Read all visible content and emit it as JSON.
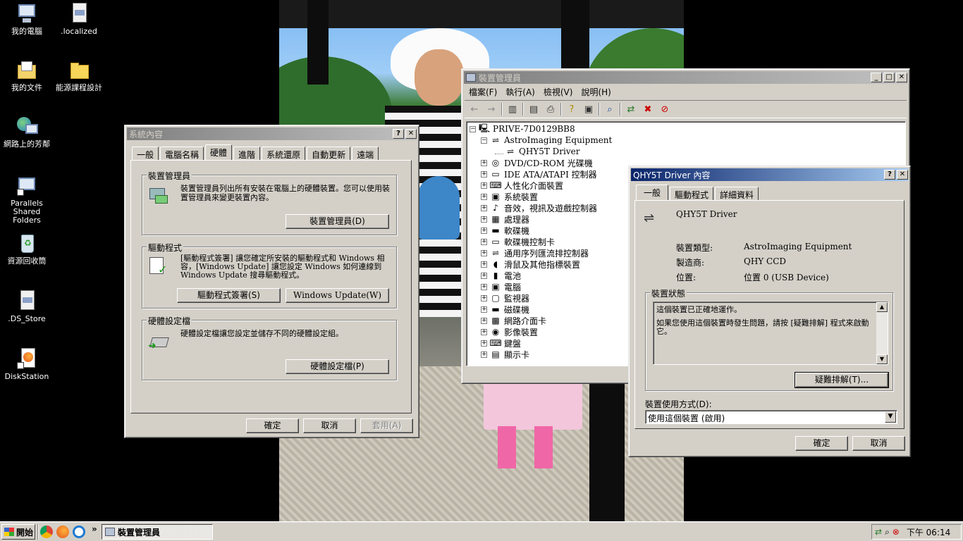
{
  "desktop": {
    "icons": [
      {
        "label": "我的電腦",
        "icon": "my-computer-icon"
      },
      {
        "label": ".localized",
        "icon": "file-icon"
      },
      {
        "label": "我的文件",
        "icon": "my-documents-icon"
      },
      {
        "label": "能源課程設計",
        "icon": "folder-icon"
      },
      {
        "label": "網路上的芳鄰",
        "icon": "network-icon"
      },
      {
        "label": "Parallels Shared Folders",
        "icon": "shared-folders-icon"
      },
      {
        "label": "資源回收筒",
        "icon": "recycle-bin-icon"
      },
      {
        "label": ".DS_Store",
        "icon": "file-icon"
      },
      {
        "label": "DiskStation",
        "icon": "firefox-shortcut-icon"
      }
    ]
  },
  "system_props": {
    "title": "系統內容",
    "tabs": [
      "一般",
      "電腦名稱",
      "硬體",
      "進階",
      "系統還原",
      "自動更新",
      "遠端"
    ],
    "selected_tab": "硬體",
    "device_manager": {
      "heading": "裝置管理員",
      "text": "裝置管理員列出所有安裝在電腦上的硬體裝置。您可以使用裝置管理員來變更裝置內容。",
      "button": "裝置管理員(D)"
    },
    "drivers": {
      "heading": "驅動程式",
      "text": "[驅動程式簽署] 讓您確定所安裝的驅動程式和 Windows 相容，[Windows Update] 讓您設定 Windows 如何連線到 Windows Update 搜尋驅動程式。",
      "btn_signing": "驅動程式簽署(S)",
      "btn_update": "Windows Update(W)"
    },
    "hw_profiles": {
      "heading": "硬體設定檔",
      "text": "硬體設定檔讓您設定並儲存不同的硬體設定組。",
      "button": "硬體設定檔(P)"
    },
    "ok": "確定",
    "cancel": "取消",
    "apply": "套用(A)"
  },
  "device_manager": {
    "title": "裝置管理員",
    "menu": [
      "檔案(F)",
      "執行(A)",
      "檢視(V)",
      "說明(H)"
    ],
    "computer": "PRIVE-7D0129BB8",
    "categories": [
      {
        "label": "AstroImaging Equipment",
        "expanded": true,
        "icon": "usb-icon"
      },
      {
        "label": "QHY5T Driver",
        "child": true,
        "icon": "usb-icon"
      },
      {
        "label": "DVD/CD-ROM 光碟機",
        "icon": "cdrom-icon"
      },
      {
        "label": "IDE ATA/ATAPI 控制器",
        "icon": "ide-controller-icon"
      },
      {
        "label": "人性化介面裝置",
        "icon": "hid-icon"
      },
      {
        "label": "系統裝置",
        "icon": "system-device-icon"
      },
      {
        "label": "音效，視訊及遊戲控制器",
        "icon": "sound-icon"
      },
      {
        "label": "處理器",
        "icon": "processor-icon"
      },
      {
        "label": "軟碟機",
        "icon": "floppy-drive-icon"
      },
      {
        "label": "軟碟機控制卡",
        "icon": "floppy-controller-icon"
      },
      {
        "label": "通用序列匯流排控制器",
        "icon": "usb-controller-icon"
      },
      {
        "label": "滑鼠及其他指標裝置",
        "icon": "mouse-icon"
      },
      {
        "label": "電池",
        "icon": "battery-icon"
      },
      {
        "label": "電腦",
        "icon": "computer-icon"
      },
      {
        "label": "監視器",
        "icon": "monitor-icon"
      },
      {
        "label": "磁碟機",
        "icon": "disk-drive-icon"
      },
      {
        "label": "網路介面卡",
        "icon": "network-adapter-icon"
      },
      {
        "label": "影像裝置",
        "icon": "imaging-device-icon"
      },
      {
        "label": "鍵盤",
        "icon": "keyboard-icon"
      },
      {
        "label": "顯示卡",
        "icon": "display-adapter-icon"
      }
    ]
  },
  "qhy_props": {
    "title": "QHY5T Driver 內容",
    "tabs": [
      "一般",
      "驅動程式",
      "詳細資料"
    ],
    "selected_tab": "一般",
    "device_name": "QHY5T Driver",
    "type_label": "裝置類型:",
    "type_value": "AstroImaging Equipment",
    "mfr_label": "製造商:",
    "mfr_value": "QHY CCD",
    "loc_label": "位置:",
    "loc_value": "位置 0 (USB Device)",
    "status_heading": "裝置狀態",
    "status_line1": "這個裝置已正確地運作。",
    "status_line2": "如果您使用這個裝置時發生問題，請按 [疑難排解] 程式來啟動它。",
    "troubleshoot": "疑難排解(T)...",
    "usage_label": "裝置使用方式(D):",
    "usage_value": "使用這個裝置 (啟用)",
    "ok": "確定",
    "cancel": "取消"
  },
  "taskbar": {
    "start": "開始",
    "task": "裝置管理員",
    "clock": "下午 06:14",
    "chevron": "»"
  }
}
